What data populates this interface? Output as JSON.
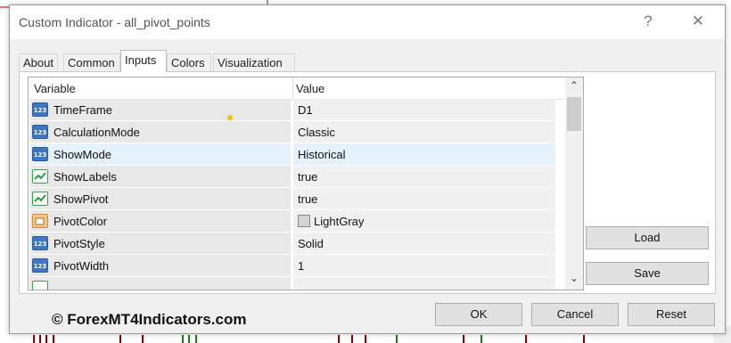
{
  "window": {
    "title": "Custom Indicator - all_pivot_points",
    "help_glyph": "?",
    "close_glyph": "✕"
  },
  "tabs": [
    {
      "label": "About"
    },
    {
      "label": "Common"
    },
    {
      "label": "Inputs"
    },
    {
      "label": "Colors"
    },
    {
      "label": "Visualization"
    }
  ],
  "grid": {
    "header_variable": "Variable",
    "header_value": "Value",
    "rows": [
      {
        "icon": "integer-icon",
        "variable": "TimeFrame",
        "value": "D1"
      },
      {
        "icon": "integer-icon",
        "variable": "CalculationMode",
        "value": "Classic"
      },
      {
        "icon": "integer-icon",
        "variable": "ShowMode",
        "value": "Historical"
      },
      {
        "icon": "boolean-icon",
        "variable": "ShowLabels",
        "value": "true"
      },
      {
        "icon": "boolean-icon",
        "variable": "ShowPivot",
        "value": "true"
      },
      {
        "icon": "color-icon",
        "variable": "PivotColor",
        "value": "LightGray"
      },
      {
        "icon": "integer-icon",
        "variable": "PivotStyle",
        "value": "Solid"
      },
      {
        "icon": "integer-icon",
        "variable": "PivotWidth",
        "value": "1"
      }
    ],
    "scroll_up_glyph": "⌃",
    "scroll_down_glyph": "⌄"
  },
  "buttons": {
    "load": "Load",
    "save": "Save",
    "ok": "OK",
    "cancel": "Cancel",
    "reset": "Reset"
  },
  "watermark": "© ForexMT4Indicators.com",
  "colors": {
    "selected_row": "#e5f1fb",
    "pivot_color_swatch": "#d3d3d3"
  }
}
